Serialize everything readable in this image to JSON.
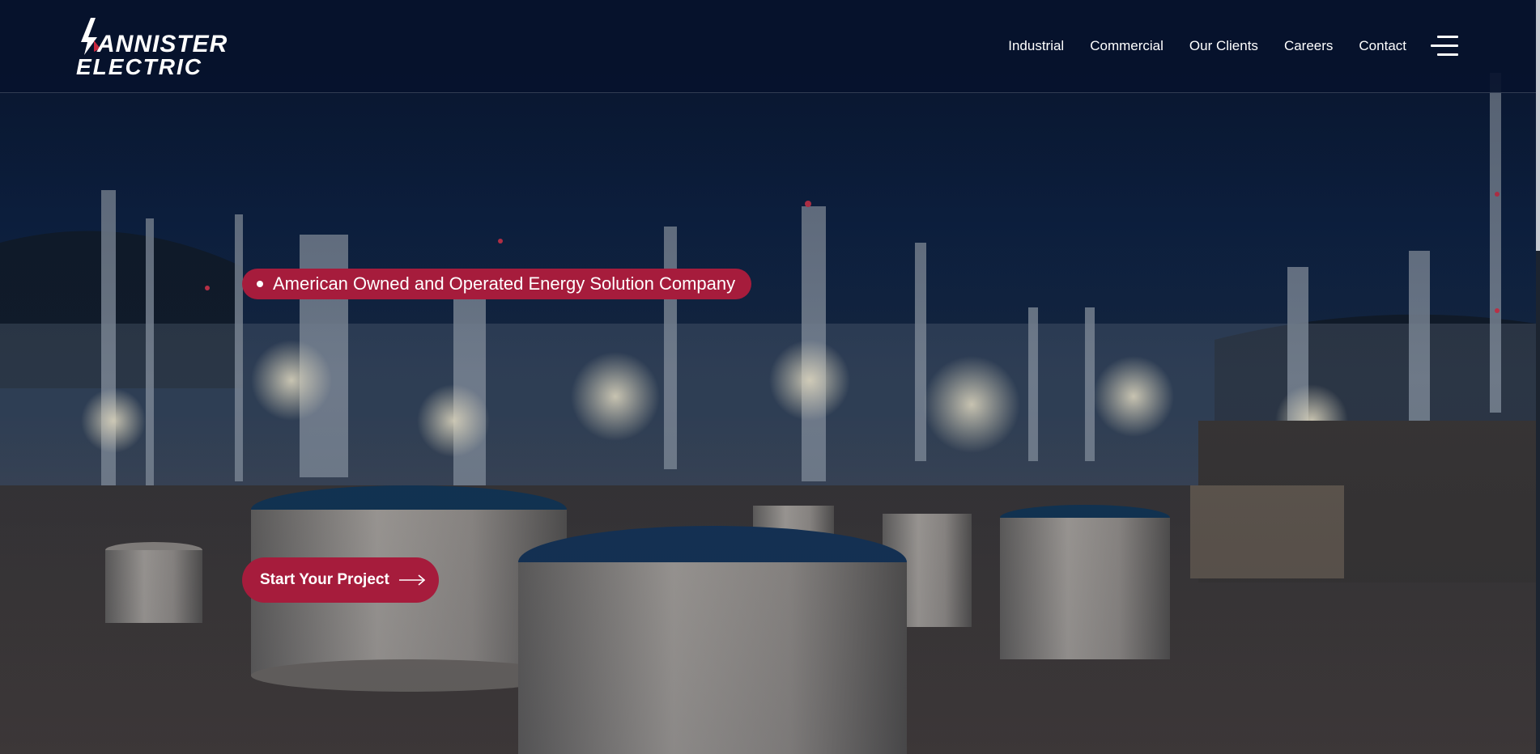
{
  "brand": {
    "name_line1": "ANNISTER",
    "name_line2": "ELECTRIC",
    "accent_color": "#a61c3c"
  },
  "nav": {
    "items": [
      {
        "label": "Industrial"
      },
      {
        "label": "Commercial"
      },
      {
        "label": "Our Clients"
      },
      {
        "label": "Careers"
      },
      {
        "label": "Contact"
      }
    ],
    "menu_icon": "hamburger-menu-icon"
  },
  "hero": {
    "tagline": "American Owned and Operated Energy Solution Company",
    "cta_label": "Start Your Project",
    "cta_icon": "arrow-right-icon",
    "background": "night-refinery-photo"
  }
}
